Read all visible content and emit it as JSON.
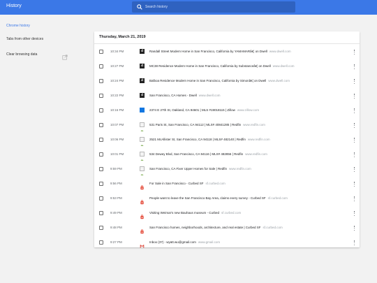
{
  "app": {
    "title": "History"
  },
  "search": {
    "placeholder": "Search history"
  },
  "sidebar": {
    "items": [
      {
        "label": "Chrome history",
        "active": true
      },
      {
        "label": "Tabs from other devices",
        "active": false
      },
      {
        "label": "Clear browsing data",
        "active": false
      }
    ]
  },
  "history": {
    "date": "Thursday, March 21, 2019",
    "entries": [
      {
        "time": "10:34 PM",
        "title": "Randall Street Modern Home in San Francisco, California by YAMAMARâ€¦ on Dwell",
        "domain": "www.dwell.com",
        "favicon": "dwell-icon"
      },
      {
        "time": "10:27 PM",
        "title": "MC38 Residence Modern Home in San Francisco, California by Substanceâ€¦ on Dwell",
        "domain": "www.dwell.com",
        "favicon": "dwell-icon"
      },
      {
        "time": "10:24 PM",
        "title": "Balboa Residence Modern Home in San Francisco, California by Simonâ€¦ on Dwell",
        "domain": "www.dwell.com",
        "favicon": "dwell-icon"
      },
      {
        "time": "10:22 PM",
        "title": "San Francisco, CA Homes - Dwell",
        "domain": "www.dwell.com",
        "favicon": "dwell-icon"
      },
      {
        "time": "10:16 PM",
        "title": "2374 E 27th St, Oakland, CA 94601 | MLS #19018115 | Zillow",
        "domain": "www.zillow.com",
        "favicon": "zillow-icon"
      },
      {
        "time": "10:07 PM",
        "title": "531 Paris St, San Francisco, CA 94112 | MLS# 40841285 | Redfin",
        "domain": "www.redfin.com",
        "favicon": "broken-image-icon"
      },
      {
        "time": "10:06 PM",
        "title": "2521 McAllister St, San Francisco, CA 94118 | MLS# 482140 | Redfin",
        "domain": "www.redfin.com",
        "favicon": "broken-image-icon"
      },
      {
        "time": "10:01 PM",
        "title": "534 Dewey Blvd, San Francisco, CA 94116 | MLS# 482856 | Redfin",
        "domain": "www.redfin.com",
        "favicon": "broken-image-icon"
      },
      {
        "time": "9:59 PM",
        "title": "San Francisco, CA Fixer Upper Homes for Sale | Redfin",
        "domain": "www.redfin.com",
        "favicon": "broken-image-icon"
      },
      {
        "time": "9:56 PM",
        "title": "For Sale in San Francisco - Curbed SF",
        "domain": "sf.curbed.com",
        "favicon": "curbed-icon"
      },
      {
        "time": "9:53 PM",
        "title": "People want to leave the San Francisco Bay Area, claims every survey - Curbed SF",
        "domain": "sf.curbed.com",
        "favicon": "curbed-icon"
      },
      {
        "time": "9:49 PM",
        "title": "Visiting Weimar's new Bauhaus museum - Curbed",
        "domain": "sf.curbed.com",
        "favicon": "curbed-icon"
      },
      {
        "time": "9:48 PM",
        "title": "San Francisco homes, neighborhoods, architecture, and real estate | Curbed SF",
        "domain": "sf.curbed.com",
        "favicon": "curbed-icon"
      },
      {
        "time": "9:27 PM",
        "title": "Inbox (37) - wyatt.wu@gmail.com",
        "domain": "www.gmail.com",
        "favicon": "gmail-icon"
      }
    ]
  },
  "colors": {
    "header": "#3b78e7",
    "search_bg": "#2f62c0",
    "accent": "#3b78e7",
    "curbed": "#e3412f",
    "gmail": "#db4437",
    "zillow": "#1277e1"
  }
}
